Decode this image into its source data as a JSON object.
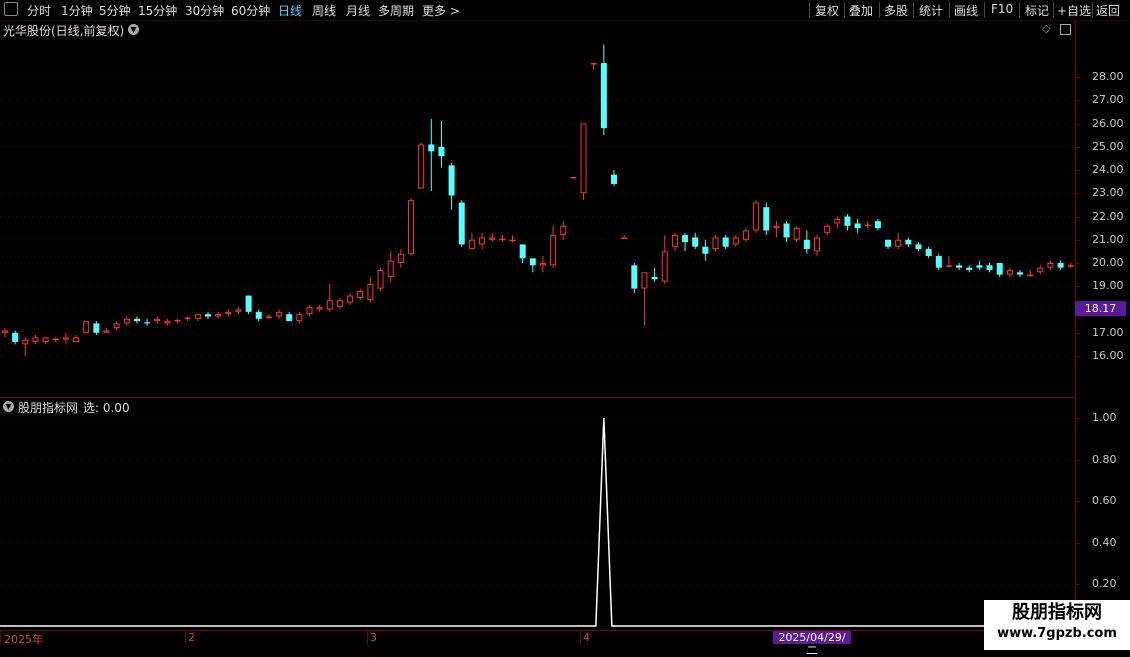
{
  "toolbar": {
    "periods": [
      "分时",
      "1分钟",
      "5分钟",
      "15分钟",
      "30分钟",
      "60分钟",
      "日线",
      "周线",
      "月线",
      "多周期",
      "更多 >"
    ],
    "active_period": "日线",
    "right_buttons": [
      "复权",
      "叠加",
      "多股",
      "统计",
      "画线",
      "F10",
      "标记",
      "+自选",
      "返回"
    ]
  },
  "main_panel": {
    "title": "光华股份(日线,前复权)",
    "current_price": "18.17"
  },
  "indicator_panel": {
    "title": "股朋指标网",
    "value_label": "选: 0.00"
  },
  "x_axis": {
    "labels": [
      "2025年",
      "2",
      "3",
      "4"
    ],
    "cursor_date": "2025/04/29/二"
  },
  "watermark": {
    "line1": "股朋指标网",
    "line2": "www.7gpzb.com"
  },
  "colors": {
    "up": "#ff3232",
    "down": "#54ffff",
    "indicator": "#ffffff",
    "grid": "#4a0000"
  },
  "chart_data": [
    {
      "type": "candlestick",
      "title": "光华股份(日线,前复权)",
      "ylim": [
        15.5,
        29.5
      ],
      "yticks": [
        "16.00",
        "17.00",
        "18.00",
        "19.00",
        "20.00",
        "21.00",
        "22.00",
        "23.00",
        "24.00",
        "25.00",
        "26.00",
        "27.00",
        "28.00"
      ],
      "candles": [
        [
          17.0,
          17.1,
          16.8,
          17.2
        ],
        [
          17.0,
          16.6,
          16.5,
          17.1
        ],
        [
          16.5,
          16.7,
          16.0,
          16.8
        ],
        [
          16.6,
          16.8,
          16.5,
          16.9
        ],
        [
          16.6,
          16.8,
          16.5,
          16.8
        ],
        [
          16.7,
          16.75,
          16.6,
          16.8
        ],
        [
          16.7,
          16.8,
          16.5,
          17.0
        ],
        [
          16.6,
          16.8,
          16.6,
          16.9
        ],
        [
          17.0,
          17.5,
          17.0,
          17.5
        ],
        [
          17.4,
          17.0,
          16.9,
          17.5
        ],
        [
          17.0,
          17.1,
          17.0,
          17.2
        ],
        [
          17.2,
          17.4,
          17.1,
          17.5
        ],
        [
          17.4,
          17.6,
          17.3,
          17.7
        ],
        [
          17.6,
          17.5,
          17.4,
          17.7
        ],
        [
          17.45,
          17.4,
          17.3,
          17.6
        ],
        [
          17.5,
          17.6,
          17.4,
          17.7
        ],
        [
          17.4,
          17.5,
          17.3,
          17.6
        ],
        [
          17.5,
          17.55,
          17.4,
          17.6
        ],
        [
          17.6,
          17.65,
          17.5,
          17.7
        ],
        [
          17.6,
          17.8,
          17.5,
          17.8
        ],
        [
          17.8,
          17.7,
          17.6,
          17.9
        ],
        [
          17.7,
          17.8,
          17.6,
          17.9
        ],
        [
          17.8,
          17.9,
          17.7,
          18.0
        ],
        [
          17.9,
          18.0,
          17.8,
          18.1
        ],
        [
          18.6,
          17.9,
          17.8,
          18.6
        ],
        [
          17.9,
          17.6,
          17.5,
          18.0
        ],
        [
          17.65,
          17.7,
          17.6,
          17.8
        ],
        [
          17.7,
          17.9,
          17.6,
          18.0
        ],
        [
          17.8,
          17.5,
          17.5,
          17.9
        ],
        [
          17.5,
          17.8,
          17.4,
          17.9
        ],
        [
          17.8,
          18.1,
          17.7,
          18.2
        ],
        [
          18.0,
          18.1,
          17.9,
          18.2
        ],
        [
          18.0,
          18.4,
          17.9,
          19.1
        ],
        [
          18.1,
          18.4,
          18.0,
          18.5
        ],
        [
          18.3,
          18.6,
          18.2,
          18.7
        ],
        [
          18.5,
          18.8,
          18.4,
          18.9
        ],
        [
          18.4,
          19.1,
          18.3,
          19.4
        ],
        [
          18.9,
          19.7,
          18.8,
          19.8
        ],
        [
          19.4,
          20.1,
          19.2,
          20.5
        ],
        [
          20.0,
          20.4,
          19.8,
          20.6
        ],
        [
          20.4,
          22.7,
          20.3,
          22.8
        ],
        [
          23.2,
          25.1,
          23.2,
          25.2
        ],
        [
          25.1,
          24.8,
          23.1,
          26.2
        ],
        [
          25.0,
          24.6,
          24.1,
          26.1
        ],
        [
          24.2,
          22.9,
          22.3,
          24.3
        ],
        [
          22.6,
          20.8,
          20.7,
          22.7
        ],
        [
          20.6,
          21.0,
          20.6,
          21.3
        ],
        [
          20.8,
          21.1,
          20.6,
          21.3
        ],
        [
          21.0,
          21.1,
          20.9,
          21.3
        ],
        [
          21.0,
          21.05,
          20.9,
          21.2
        ],
        [
          21.0,
          21.0,
          20.9,
          21.2
        ],
        [
          20.8,
          20.2,
          20.0,
          20.8
        ],
        [
          20.2,
          19.9,
          19.6,
          20.2
        ],
        [
          19.9,
          20.0,
          19.6,
          20.3
        ],
        [
          19.9,
          21.2,
          19.8,
          21.6
        ],
        [
          21.2,
          21.6,
          21.0,
          21.8
        ],
        [
          23.7,
          23.7,
          23.7,
          23.7
        ],
        [
          23.0,
          26.0,
          22.7,
          26.0
        ],
        [
          28.6,
          28.6,
          28.3,
          28.6
        ],
        [
          28.6,
          25.8,
          25.5,
          29.4
        ],
        [
          23.8,
          23.4,
          23.3,
          24.0
        ],
        [
          21.1,
          21.1,
          21.1,
          21.2
        ],
        [
          19.9,
          18.9,
          18.7,
          20.0
        ],
        [
          18.9,
          19.6,
          17.3,
          19.6
        ],
        [
          19.4,
          19.3,
          19.2,
          19.8
        ],
        [
          19.2,
          20.5,
          19.1,
          21.2
        ],
        [
          20.7,
          21.2,
          20.5,
          21.3
        ],
        [
          21.2,
          20.9,
          20.5,
          21.3
        ],
        [
          21.1,
          20.7,
          20.6,
          21.3
        ],
        [
          20.7,
          20.4,
          20.1,
          21.0
        ],
        [
          20.6,
          21.1,
          20.5,
          21.2
        ],
        [
          21.1,
          20.7,
          20.6,
          21.2
        ],
        [
          20.8,
          21.1,
          20.7,
          21.2
        ],
        [
          21.0,
          21.4,
          20.9,
          21.5
        ],
        [
          21.4,
          22.6,
          21.3,
          22.7
        ],
        [
          22.4,
          21.4,
          21.2,
          22.6
        ],
        [
          21.5,
          21.6,
          21.1,
          21.8
        ],
        [
          21.7,
          21.1,
          20.9,
          21.8
        ],
        [
          21.0,
          21.5,
          20.9,
          21.6
        ],
        [
          21.0,
          20.6,
          20.4,
          21.4
        ],
        [
          20.5,
          21.1,
          20.3,
          21.2
        ],
        [
          21.3,
          21.6,
          21.2,
          21.7
        ],
        [
          21.7,
          21.9,
          21.5,
          22.0
        ],
        [
          22.0,
          21.6,
          21.4,
          22.1
        ],
        [
          21.7,
          21.5,
          21.3,
          21.9
        ],
        [
          21.6,
          21.65,
          21.5,
          21.8
        ],
        [
          21.8,
          21.5,
          21.4,
          21.9
        ],
        [
          21.0,
          20.7,
          20.6,
          21.0
        ],
        [
          20.7,
          21.0,
          20.6,
          21.3
        ],
        [
          21.0,
          20.8,
          20.7,
          21.1
        ],
        [
          20.8,
          20.6,
          20.5,
          20.9
        ],
        [
          20.6,
          20.3,
          20.2,
          20.7
        ],
        [
          20.3,
          19.8,
          19.7,
          20.4
        ],
        [
          19.9,
          19.9,
          19.8,
          20.3
        ],
        [
          19.9,
          19.8,
          19.7,
          20.0
        ],
        [
          19.8,
          19.7,
          19.6,
          19.9
        ],
        [
          19.9,
          19.8,
          19.7,
          20.1
        ],
        [
          19.9,
          19.7,
          19.6,
          20.0
        ],
        [
          20.0,
          19.5,
          19.4,
          20.0
        ],
        [
          19.5,
          19.7,
          19.4,
          19.8
        ],
        [
          19.6,
          19.5,
          19.4,
          19.7
        ],
        [
          19.5,
          19.5,
          19.4,
          19.7
        ],
        [
          19.6,
          19.8,
          19.5,
          19.9
        ],
        [
          19.8,
          20.0,
          19.7,
          20.1
        ],
        [
          20.0,
          19.8,
          19.7,
          20.1
        ],
        [
          19.9,
          19.9,
          19.8,
          20.0
        ],
        [
          19.9,
          19.95,
          19.8,
          20.0
        ],
        [
          19.9,
          19.9,
          19.8,
          20.0
        ],
        [
          20.0,
          19.7,
          19.6,
          20.0
        ]
      ]
    },
    {
      "type": "line",
      "title": "股朋指标网",
      "ylim": [
        0,
        1.02
      ],
      "yticks": [
        "0.20",
        "0.40",
        "0.60",
        "0.80",
        "1.00"
      ],
      "spike_index": 59,
      "spike_value": 1.0
    }
  ]
}
